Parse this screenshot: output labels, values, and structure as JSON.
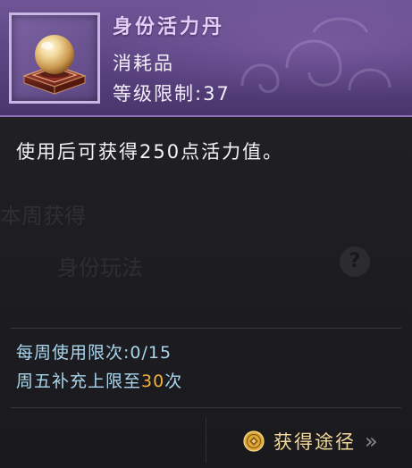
{
  "item": {
    "name": "身份活力丹",
    "type": "消耗品",
    "level_label": "等级限制:",
    "level_value": "37",
    "quality_color": "#5a4380",
    "icon": "pearl-on-pedestal-icon"
  },
  "description": "使用后可获得250点活力值。",
  "limits": {
    "weekly_label": "每周使用限次:",
    "weekly_value": "0/15",
    "friday_prefix": "周五补充上限至",
    "friday_value": "30",
    "friday_suffix": "次"
  },
  "source": {
    "label": "获得途径",
    "icon": "coin-icon",
    "chevron": "»"
  },
  "background_ui": {
    "text_1": "本周获得",
    "text_2": "身份玩法",
    "help_glyph": "?"
  }
}
